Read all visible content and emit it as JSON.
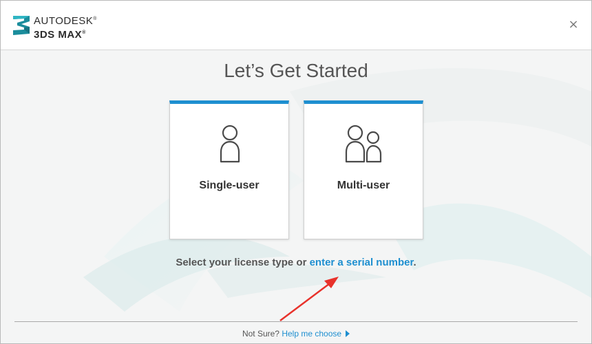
{
  "header": {
    "brand_line1": "AUTODESK",
    "brand_line2": "3DS MAX",
    "logo_icon": "3ds-max-logo-icon",
    "close_glyph": "×"
  },
  "main": {
    "title": "Let’s Get Started",
    "cards": [
      {
        "label": "Single-user",
        "icon": "single-user-icon"
      },
      {
        "label": "Multi-user",
        "icon": "multi-user-icon"
      }
    ],
    "prompt_text": "Select your license type or ",
    "prompt_link": "enter a serial number",
    "prompt_end": "."
  },
  "footer": {
    "not_sure": "Not Sure?",
    "help_link": "Help me choose"
  },
  "colors": {
    "accent": "#1e8fd0",
    "annotation_arrow": "#e8322b"
  }
}
